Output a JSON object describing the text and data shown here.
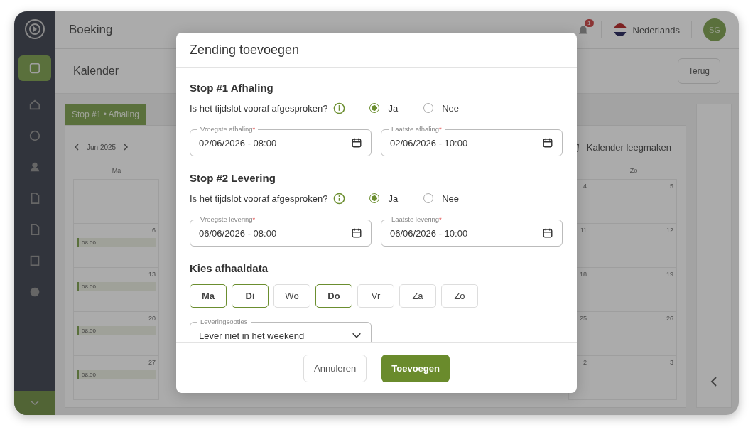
{
  "topbar": {
    "title": "Boeking",
    "notification_count": "1",
    "language": "Nederlands",
    "avatar": "SG"
  },
  "page": {
    "title": "Kalender",
    "back_button": "Terug"
  },
  "calendar": {
    "tabs": [
      {
        "label": "Stop #1 • Afhaling",
        "selected": true
      }
    ],
    "month": "Jun 2025",
    "clear_button": "Kalender leegmaken",
    "columns": [
      {
        "header": "Ma",
        "days": [
          {
            "day": "6",
            "event": "08:00"
          },
          {
            "day": "13",
            "event": "08:00"
          },
          {
            "day": "20",
            "event": "08:00"
          },
          {
            "day": "27",
            "event": "08:00"
          }
        ]
      },
      {
        "days": [
          {
            "day": "4"
          },
          {
            "day": "11"
          },
          {
            "day": "18"
          },
          {
            "day": "25"
          },
          {
            "day": "2"
          }
        ]
      },
      {
        "header": "Zo",
        "days": [
          {
            "day": "5"
          },
          {
            "day": "12"
          },
          {
            "day": "19"
          },
          {
            "day": "26"
          },
          {
            "day": "3"
          }
        ]
      }
    ]
  },
  "dialog": {
    "title": "Zending toevoegen",
    "stops": [
      {
        "title": "Stop #1 Afhaling",
        "question": "Is het tijdslot vooraf afgesproken?",
        "options": [
          {
            "label": "Ja",
            "selected": true
          },
          {
            "label": "Nee",
            "selected": false
          }
        ],
        "fields": [
          {
            "label": "Vroegste afhaling",
            "required_mark": "*",
            "value": "02/06/2026 - 08:00"
          },
          {
            "label": "Laatste afhaling",
            "required_mark": "*",
            "value": "02/06/2026 - 10:00"
          }
        ]
      },
      {
        "title": "Stop #2 Levering",
        "question": "Is het tijdslot vooraf afgesproken?",
        "options": [
          {
            "label": "Ja",
            "selected": true
          },
          {
            "label": "Nee",
            "selected": false
          }
        ],
        "fields": [
          {
            "label": "Vroegste levering",
            "required_mark": "*",
            "value": "06/06/2026 - 08:00"
          },
          {
            "label": "Laatste levering",
            "required_mark": "*",
            "value": "06/06/2026 - 10:00"
          }
        ]
      }
    ],
    "days_title": "Kies afhaaldata",
    "days": [
      {
        "label": "Ma",
        "selected": true
      },
      {
        "label": "Di",
        "selected": true
      },
      {
        "label": "Wo",
        "selected": false
      },
      {
        "label": "Do",
        "selected": true
      },
      {
        "label": "Vr",
        "selected": false
      },
      {
        "label": "Za",
        "selected": false
      },
      {
        "label": "Zo",
        "selected": false
      }
    ],
    "delivery": {
      "label": "Leveringsopties",
      "value": "Lever niet in het weekend"
    },
    "buttons": [
      {
        "label": "Annuleren",
        "kind": "secondary"
      },
      {
        "label": "Toevoegen",
        "kind": "primary"
      }
    ]
  }
}
